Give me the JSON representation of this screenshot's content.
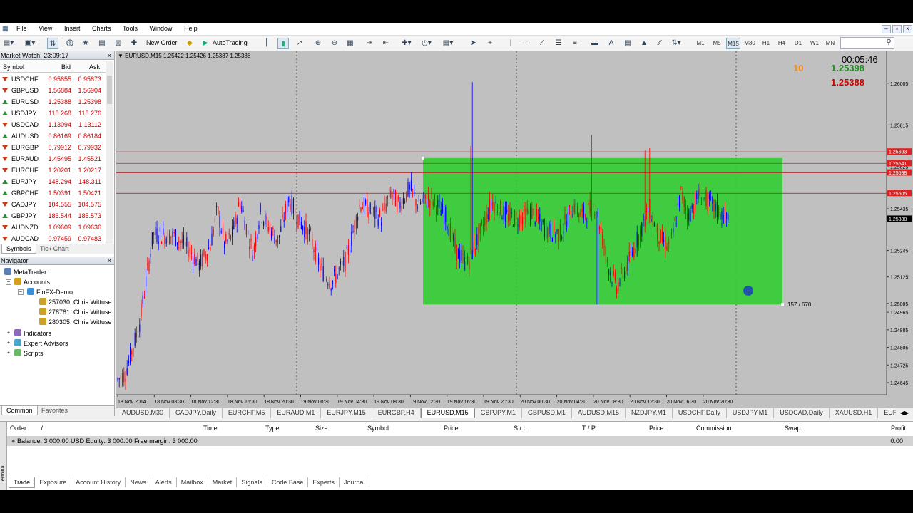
{
  "menu": [
    "File",
    "View",
    "Insert",
    "Charts",
    "Tools",
    "Window",
    "Help"
  ],
  "toolbar": {
    "new_order": "New Order",
    "autotrading": "AutoTrading",
    "timeframes": [
      "M1",
      "M5",
      "M15",
      "M30",
      "H1",
      "H4",
      "D1",
      "W1",
      "MN"
    ],
    "active_timeframe": "M15"
  },
  "market_watch": {
    "title": "Market Watch: 23:09:17",
    "col_symbol": "Symbol",
    "col_bid": "Bid",
    "col_ask": "Ask",
    "rows": [
      {
        "symbol": "USDCHF",
        "bid": "0.95855",
        "ask": "0.95873",
        "dir": "dn"
      },
      {
        "symbol": "GBPUSD",
        "bid": "1.56884",
        "ask": "1.56904",
        "dir": "dn"
      },
      {
        "symbol": "EURUSD",
        "bid": "1.25388",
        "ask": "1.25398",
        "dir": "up"
      },
      {
        "symbol": "USDJPY",
        "bid": "118.268",
        "ask": "118.276",
        "dir": "up"
      },
      {
        "symbol": "USDCAD",
        "bid": "1.13094",
        "ask": "1.13112",
        "dir": "dn"
      },
      {
        "symbol": "AUDUSD",
        "bid": "0.86169",
        "ask": "0.86184",
        "dir": "up"
      },
      {
        "symbol": "EURGBP",
        "bid": "0.79912",
        "ask": "0.79932",
        "dir": "dn"
      },
      {
        "symbol": "EURAUD",
        "bid": "1.45495",
        "ask": "1.45521",
        "dir": "dn"
      },
      {
        "symbol": "EURCHF",
        "bid": "1.20201",
        "ask": "1.20217",
        "dir": "dn"
      },
      {
        "symbol": "EURJPY",
        "bid": "148.294",
        "ask": "148.311",
        "dir": "up"
      },
      {
        "symbol": "GBPCHF",
        "bid": "1.50391",
        "ask": "1.50421",
        "dir": "up"
      },
      {
        "symbol": "CADJPY",
        "bid": "104.555",
        "ask": "104.575",
        "dir": "dn"
      },
      {
        "symbol": "GBPJPY",
        "bid": "185.544",
        "ask": "185.573",
        "dir": "up"
      },
      {
        "symbol": "AUDNZD",
        "bid": "1.09609",
        "ask": "1.09636",
        "dir": "dn"
      },
      {
        "symbol": "AUDCAD",
        "bid": "0.97459",
        "ask": "0.97483",
        "dir": "dn"
      }
    ],
    "tabs": [
      "Symbols",
      "Tick Chart"
    ]
  },
  "navigator": {
    "title": "Navigator",
    "root": "MetaTrader",
    "accounts": "Accounts",
    "server": "FinFX-Demo",
    "account_list": [
      "257030: Chris Wittuse",
      "278781: Chris Wittuse",
      "280305: Chris Wittuse"
    ],
    "indicators": "Indicators",
    "experts": "Expert Advisors",
    "scripts": "Scripts",
    "tabs": [
      "Common",
      "Favorites"
    ]
  },
  "chart": {
    "header": "EURUSD,M15  1.25422 1.25426 1.25387 1.25388",
    "timer": "00:05:46",
    "spread": "10",
    "ask_price": "1.25398",
    "bid_price": "1.25388",
    "cursor_label": "157 / 670",
    "price_ticks": [
      "1.26005",
      "1.25815",
      "1.25625",
      "1.25435",
      "1.25245",
      "1.25125",
      "1.25005",
      "1.24965",
      "1.24885",
      "1.24805",
      "1.24725",
      "1.24645"
    ],
    "line_labels": [
      "1.25693",
      "1.25641",
      "1.25598",
      "1.25505",
      "1.25388"
    ],
    "time_ticks": [
      "18 Nov 2014",
      "18 Nov 08:30",
      "18 Nov 12:30",
      "18 Nov 16:30",
      "18 Nov 20:30",
      "19 Nov 00:30",
      "19 Nov 04:30",
      "19 Nov 08:30",
      "19 Nov 12:30",
      "19 Nov 16:30",
      "19 Nov 20:30",
      "20 Nov 00:30",
      "20 Nov 04:30",
      "20 Nov 08:30",
      "20 Nov 12:30",
      "20 Nov 16:30",
      "20 Nov 20:30"
    ],
    "colors": {
      "bg": "#c0c0c0",
      "bull": "#0000ff",
      "bear": "#ff0000",
      "rect": "#32cd32",
      "level": "#b03030",
      "ask": "#228b22",
      "bid": "#cc0000",
      "spread": "#ff8c00"
    }
  },
  "chart_tabs": [
    "AUDUSD,M30",
    "CADJPY,Daily",
    "EURCHF,M5",
    "EURAUD,M1",
    "EURJPY,M15",
    "EURGBP,H4",
    "EURUSD,M15",
    "GBPJPY,M1",
    "GBPUSD,M1",
    "AUDUSD,M15",
    "NZDJPY,M1",
    "USDCHF,Daily",
    "USDJPY,M1",
    "USDCAD,Daily",
    "XAUUSD,H1",
    "EURNOK,M15",
    "US"
  ],
  "chart_tab_active": "EURUSD,M15",
  "terminal": {
    "columns": [
      "Order",
      "Time",
      "Type",
      "Size",
      "Symbol",
      "Price",
      "S / L",
      "T / P",
      "Price",
      "Commission",
      "Swap",
      "Profit"
    ],
    "order_sort": "/",
    "balance": "Balance: 3 000.00 USD  Equity: 3 000.00  Free margin: 3 000.00",
    "profit": "0.00",
    "side_label": "Terminal",
    "tabs": [
      "Trade",
      "Exposure",
      "Account History",
      "News",
      "Alerts",
      "Mailbox",
      "Market",
      "Signals",
      "Code Base",
      "Experts",
      "Journal"
    ]
  }
}
